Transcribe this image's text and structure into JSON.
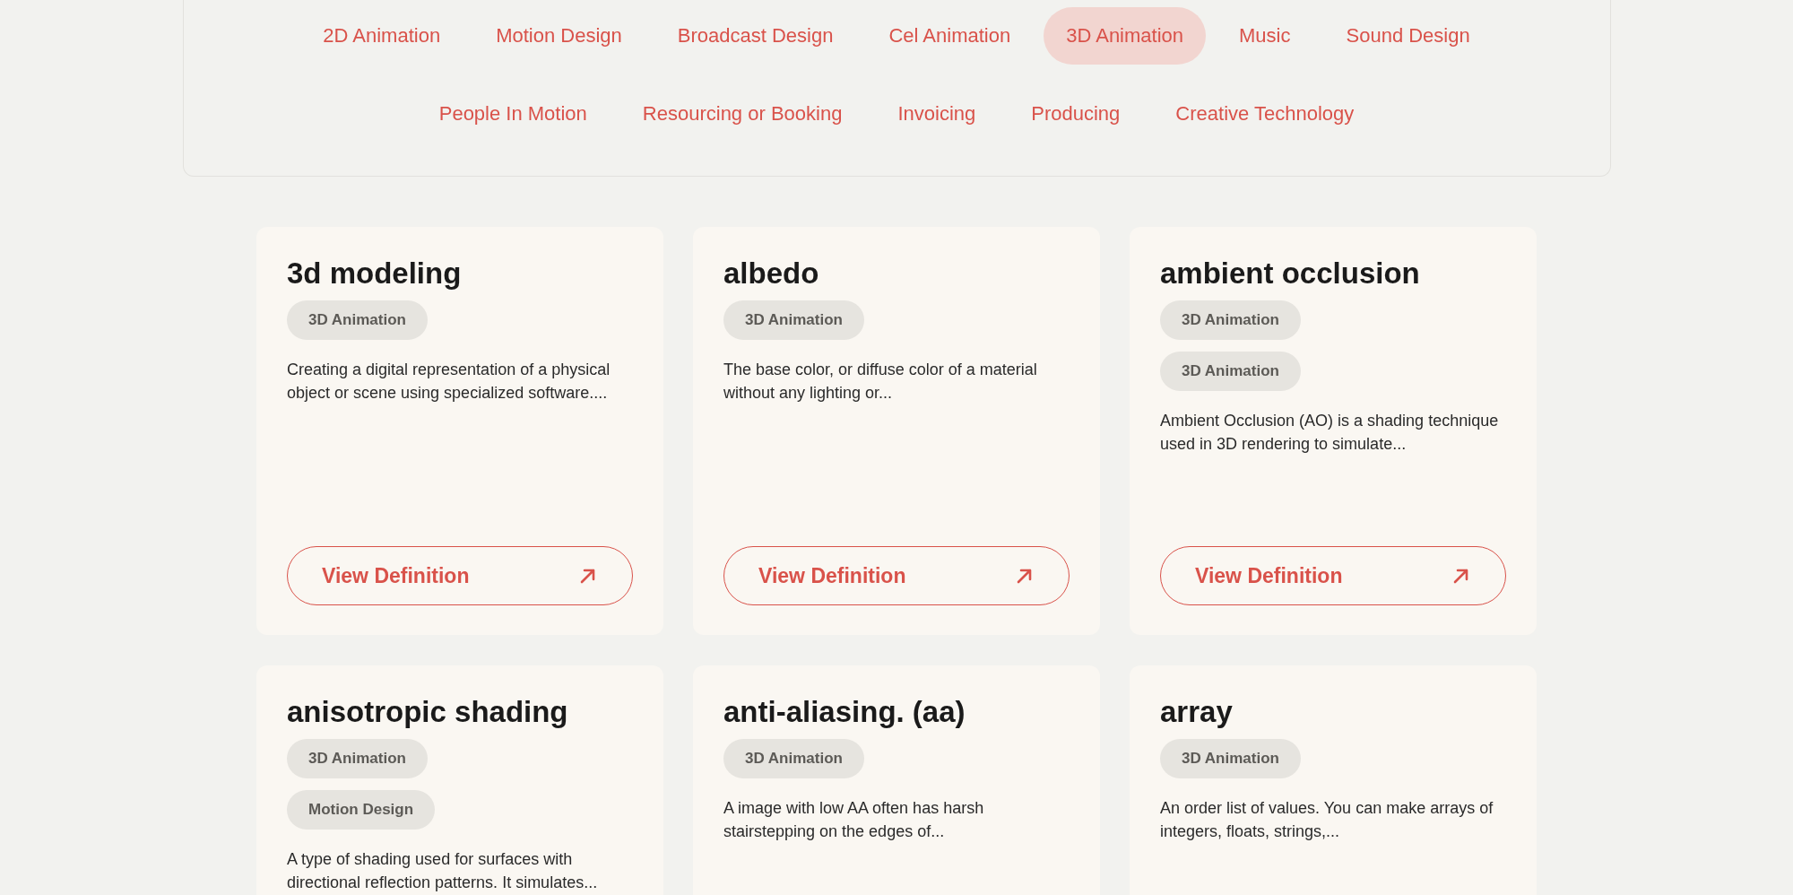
{
  "category_filter": {
    "tab_rows": [
      {
        "tabs": [
          {
            "label": "2D Animation",
            "selected": false
          },
          {
            "label": "Motion Design",
            "selected": false
          },
          {
            "label": "Broadcast Design",
            "selected": false
          },
          {
            "label": "Cel Animation",
            "selected": false
          },
          {
            "label": "3D Animation",
            "selected": true
          },
          {
            "label": "Music",
            "selected": false
          },
          {
            "label": "Sound Design",
            "selected": false
          }
        ]
      },
      {
        "tabs": [
          {
            "label": "People In Motion",
            "selected": false
          },
          {
            "label": "Resourcing or Booking",
            "selected": false
          },
          {
            "label": "Invoicing",
            "selected": false
          },
          {
            "label": "Producing",
            "selected": false
          },
          {
            "label": "Creative Technology",
            "selected": false
          }
        ]
      }
    ]
  },
  "glossary_cards": [
    {
      "title": "3d modeling",
      "tags": [
        "3D Animation"
      ],
      "description": "Creating a digital representation of a physical object or scene using specialized software....",
      "button": "View Definition"
    },
    {
      "title": "albedo",
      "tags": [
        "3D Animation"
      ],
      "description": "The base color, or diffuse color of a material without any lighting or...",
      "button": "View Definition"
    },
    {
      "title": "ambient occlusion",
      "tags": [
        "3D Animation",
        "3D Animation"
      ],
      "description": "Ambient Occlusion (AO) is a shading technique used in 3D rendering to simulate...",
      "button": "View Definition"
    },
    {
      "title": "anisotropic shading",
      "tags": [
        "3D Animation",
        "Motion Design"
      ],
      "description": "A type of shading used for surfaces with directional reflection patterns. It simulates..."
    },
    {
      "title": "anti-aliasing. (aa)",
      "tags": [
        "3D Animation"
      ],
      "description": "A image with low AA often has harsh stairstepping on the edges of..."
    },
    {
      "title": "array",
      "tags": [
        "3D Animation"
      ],
      "description": "An order list of values. You can make arrays of integers, floats, strings,..."
    }
  ]
}
